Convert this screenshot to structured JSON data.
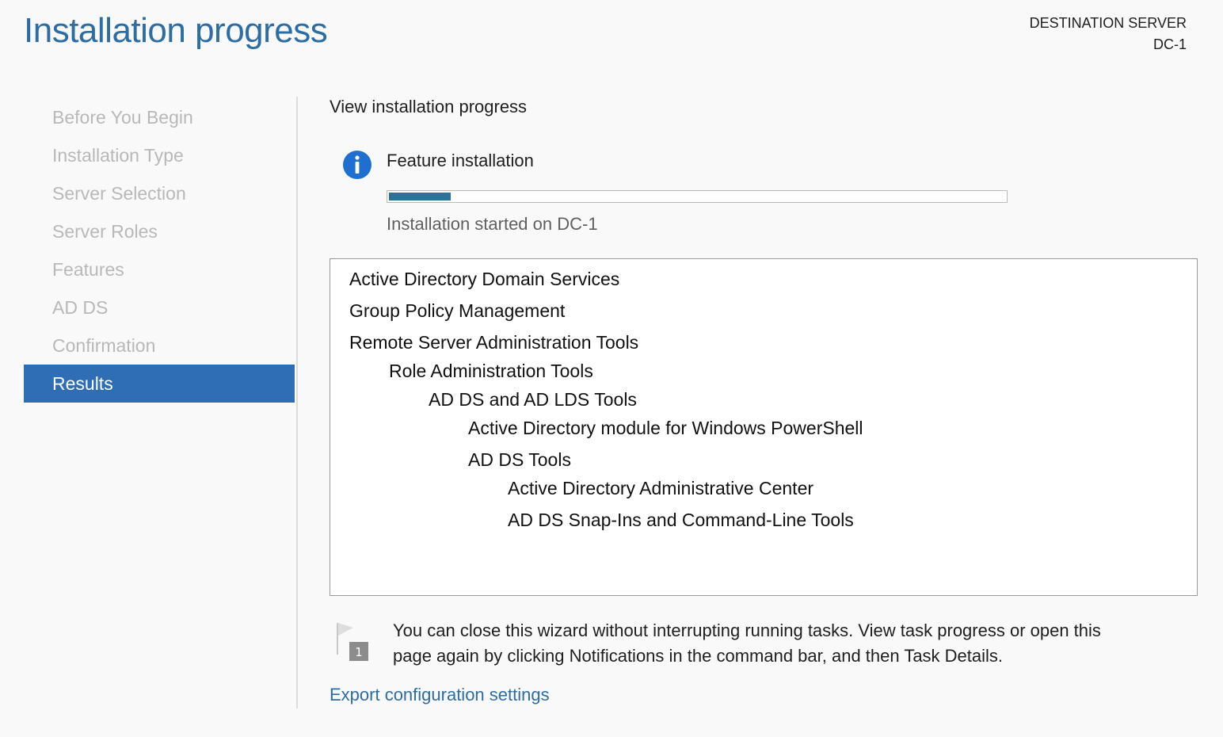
{
  "header": {
    "title": "Installation progress",
    "destination_label": "DESTINATION SERVER",
    "destination_server": "DC-1"
  },
  "nav": {
    "items": [
      {
        "label": "Before You Begin",
        "active": false
      },
      {
        "label": "Installation Type",
        "active": false
      },
      {
        "label": "Server Selection",
        "active": false
      },
      {
        "label": "Server Roles",
        "active": false
      },
      {
        "label": "Features",
        "active": false
      },
      {
        "label": "AD DS",
        "active": false
      },
      {
        "label": "Confirmation",
        "active": false
      },
      {
        "label": "Results",
        "active": true
      }
    ]
  },
  "main": {
    "heading": "View installation progress",
    "status_icon": "info-icon",
    "status_label": "Feature installation",
    "progress_percent": 10,
    "started_text": "Installation started on DC-1",
    "features": [
      {
        "label": "Active Directory Domain Services",
        "level": 0
      },
      {
        "label": "Group Policy Management",
        "level": 0
      },
      {
        "label": "Remote Server Administration Tools",
        "level": 0
      },
      {
        "label": "Role Administration Tools",
        "level": 1
      },
      {
        "label": "AD DS and AD LDS Tools",
        "level": 2
      },
      {
        "label": "Active Directory module for Windows PowerShell",
        "level": 3
      },
      {
        "label": "AD DS Tools",
        "level": 3
      },
      {
        "label": "Active Directory Administrative Center",
        "level": 4
      },
      {
        "label": "AD DS Snap-Ins and Command-Line Tools",
        "level": 4
      }
    ],
    "note_icon": "notification-flag-icon",
    "note_badge": "1",
    "note_line1": "You can close this wizard without interrupting running tasks. View task progress or open this",
    "note_line2": "page again by clicking Notifications in the command bar, and then Task Details.",
    "export_link": "Export configuration settings"
  },
  "colors": {
    "accent": "#2d6da3",
    "nav_active_bg": "#2f6eb5",
    "progress_fill": "#2c7299",
    "nav_inactive_text": "#b8b8b8"
  }
}
